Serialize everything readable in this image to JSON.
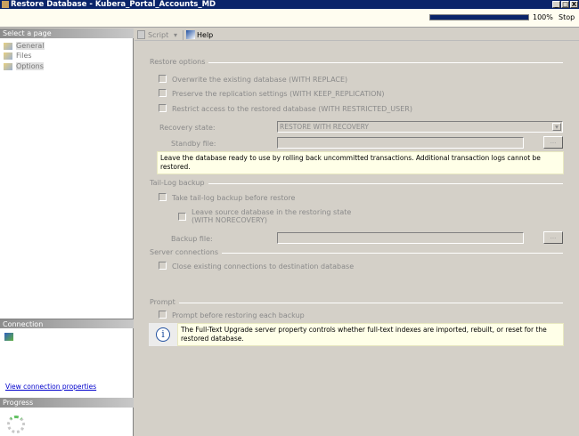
{
  "window": {
    "title": "Restore Database - Kubera_Portal_Accounts_MD",
    "controls": [
      "_",
      "□",
      "X"
    ]
  },
  "status": {
    "progress_percent": 100,
    "progress_label": "100%",
    "stop_label": "Stop"
  },
  "sidebar": {
    "select_page_header": "Select a page",
    "pages": [
      {
        "label": "General"
      },
      {
        "label": "Files"
      },
      {
        "label": "Options"
      }
    ],
    "connection_header": "Connection",
    "view_connection_link": "View connection properties",
    "progress_header": "Progress"
  },
  "toolbar": {
    "script_label": "Script",
    "help_label": "Help"
  },
  "restore_options": {
    "title": "Restore options",
    "overwrite": "Overwrite the existing database (WITH REPLACE)",
    "preserve": "Preserve the replication settings (WITH KEEP_REPLICATION)",
    "restrict": "Restrict access to the restored database (WITH RESTRICTED_USER)",
    "recovery_state_label": "Recovery state:",
    "recovery_state_value": "RESTORE WITH RECOVERY",
    "standby_label": "Standby file:",
    "standby_value": "",
    "browse": "...",
    "description": "Leave the database ready to use by rolling back uncommitted transactions. Additional transaction logs cannot be restored."
  },
  "tail_log": {
    "title": "Tail-Log backup",
    "take_backup": "Take tail-log backup before restore",
    "leave_source_line1": "Leave source database in the restoring state",
    "leave_source_line2": "(WITH NORECOVERY)",
    "backup_file_label": "Backup file:",
    "backup_file_value": "",
    "browse": "..."
  },
  "server_connections": {
    "title": "Server connections",
    "close_existing": "Close existing connections to destination database"
  },
  "prompt": {
    "title": "Prompt",
    "prompt_before": "Prompt before restoring each backup",
    "info": "The Full-Text Upgrade server property controls whether full-text indexes are imported, rebuilt, or reset for the restored database."
  }
}
